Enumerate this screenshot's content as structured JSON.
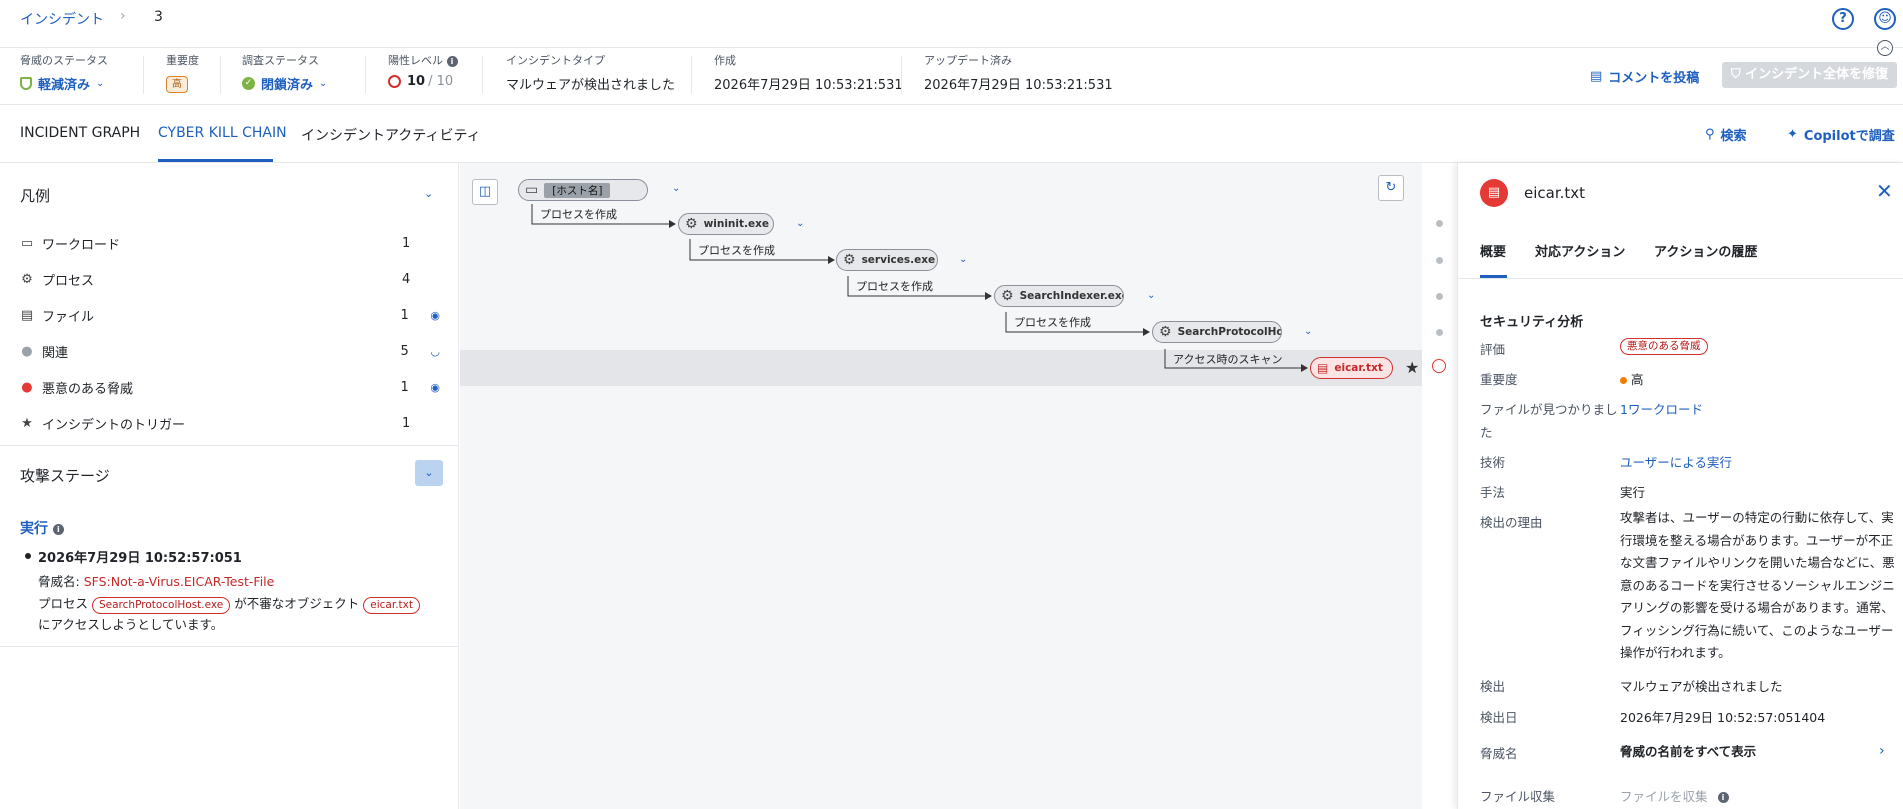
{
  "breadcrumb": {
    "root": "インシデント",
    "separator": "›",
    "current": "3"
  },
  "header": {
    "threat_status": {
      "label": "脅威のステータス",
      "value": "軽減済み"
    },
    "severity": {
      "label": "重要度",
      "value": "高"
    },
    "investigation_status": {
      "label": "調査ステータス",
      "value": "閉鎖済み"
    },
    "positivity_level": {
      "label": "陽性レベル",
      "value": "10",
      "max": "/ 10"
    },
    "incident_type": {
      "label": "インシデントタイプ",
      "value": "マルウェアが検出されました"
    },
    "created": {
      "label": "作成",
      "value": "2026年7月29日 10:53:21:531"
    },
    "updated": {
      "label": "アップデート済み",
      "value": "2026年7月29日 10:53:21:531"
    },
    "comment_button": "コメントを投稿",
    "remediate_button": "インシデント全体を修復"
  },
  "tabs": [
    {
      "label": "INCIDENT GRAPH"
    },
    {
      "label": "CYBER KILL CHAIN"
    },
    {
      "label": "インシデントアクティビティ"
    }
  ],
  "tab_actions": {
    "search": "検索",
    "copilot": "Copilotで調査"
  },
  "legend": {
    "title": "凡例",
    "items": [
      {
        "label": "ワークロード",
        "count": "1",
        "icon": "workload-icon"
      },
      {
        "label": "プロセス",
        "count": "4",
        "icon": "gear-icon"
      },
      {
        "label": "ファイル",
        "count": "1",
        "icon": "file-icon"
      },
      {
        "label": "関連",
        "count": "5",
        "icon": "gray-dot-icon"
      },
      {
        "label": "悪意のある脅威",
        "count": "1",
        "icon": "red-dot-icon"
      },
      {
        "label": "インシデントのトリガー",
        "count": "1",
        "icon": "star-icon"
      }
    ]
  },
  "attack_stage": {
    "title": "攻撃ステージ",
    "stage_name": "実行",
    "timestamp": "2026年7月29日 10:52:57:051",
    "threat_label": "脅威名: ",
    "threat_name": "SFS:Not-a-Virus.EICAR-Test-File",
    "process_prefix": "プロセス",
    "process_name": "SearchProtocolHost.exe",
    "object_text": "が不審なオブジェクト",
    "object_name": "eicar.txt",
    "suffix": "にアクセスしようとしています。"
  },
  "graph": {
    "nodes": [
      {
        "label": "[ホスト名]"
      },
      {
        "label": "wininit.exe"
      },
      {
        "label": "services.exe"
      },
      {
        "label": "SearchIndexer.exe"
      },
      {
        "label": "SearchProtocolHost.exe"
      },
      {
        "label": "eicar.txt"
      }
    ],
    "edges": [
      {
        "label": "プロセスを作成"
      },
      {
        "label": "プロセスを作成"
      },
      {
        "label": "プロセスを作成"
      },
      {
        "label": "プロセスを作成"
      },
      {
        "label": "アクセス時のスキャン"
      }
    ]
  },
  "detail_panel": {
    "title": "eicar.txt",
    "tabs": [
      "概要",
      "対応アクション",
      "アクションの履歴"
    ],
    "section": "セキュリティ分析",
    "rows": {
      "rating": {
        "key": "評価",
        "value": "悪意のある脅威"
      },
      "severity": {
        "key": "重要度",
        "value": "高"
      },
      "found_on": {
        "key": "ファイルが見つかりました",
        "value": "1ワークロード"
      },
      "technique": {
        "key": "技術",
        "value": "ユーザーによる実行"
      },
      "tactic": {
        "key": "手法",
        "value": "実行"
      },
      "reason": {
        "key": "検出の理由",
        "value": "攻撃者は、ユーザーの特定の行動に依存して、実行環境を整える場合があります。ユーザーが不正な文書ファイルやリンクを開いた場合などに、悪意のあるコードを実行させるソーシャルエンジニアリングの影響を受ける場合があります。通常、フィッシング行為に続いて、このようなユーザー操作が行われます。"
      },
      "detection": {
        "key": "検出",
        "value": "マルウェアが検出されました"
      },
      "detected_at": {
        "key": "検出日",
        "value": "2026年7月29日 10:52:57:051404"
      },
      "threat_name": {
        "key": "脅威名",
        "value": "脅威の名前をすべて表示"
      },
      "file_collect": {
        "key": "ファイル収集",
        "value": "ファイルを収集"
      }
    }
  },
  "colors": {
    "accent": "#1f5fbf",
    "danger": "#d32f2f",
    "success": "#7cb342",
    "warning": "#d9822b"
  }
}
